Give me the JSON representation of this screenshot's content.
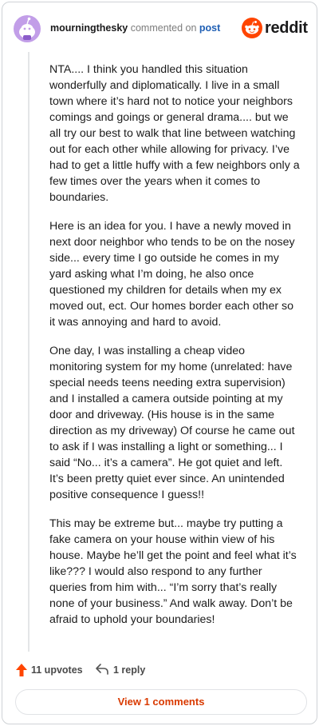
{
  "header": {
    "username": "mourningthesky",
    "commented_on": "commented on",
    "post_link": "post",
    "brand": "reddit"
  },
  "comment": {
    "paragraphs": [
      "NTA.... I think you handled this situation wonderfully and diplomatically. I live in a small town where it’s hard not to notice your neighbors comings and goings or general drama.... but we all try our best to walk that line between watching out for each other while allowing for privacy. I’ve had to get a little huffy with a few neighbors only a few times over the years when it comes to boundaries.",
      "Here is an idea for you. I have a newly moved in next door neighbor who tends to be on the nosey side... every time I go outside he comes in my yard asking what I’m doing, he also once questioned my children for details when my ex moved out, ect. Our homes border each other so it was annoying and hard to avoid.",
      "One day, I was installing a cheap video monitoring system for my home (unrelated: have special needs teens needing extra supervision) and I installed a camera outside pointing at my door and driveway. (His house is in the same direction as my driveway) Of course he came out to ask if I was installing a light or something... I said “No... it’s a camera”. He got quiet and left. It’s been pretty quiet ever since. An unintended positive consequence I guess!!",
      "This may be extreme but... maybe try putting a fake camera on your house within view of his house. Maybe he’ll get the point and feel what it’s like??? I would also respond to any further queries from him with... “I’m sorry that’s really none of your business.” And walk away. Don’t be afraid to uphold your boundaries!"
    ]
  },
  "actions": {
    "upvotes": "11 upvotes",
    "replies": "1 reply",
    "view_comments": "View 1 comments"
  },
  "colors": {
    "brand_orange": "#ff4500",
    "link_blue": "#1f5fb4",
    "button_text": "#d93a00",
    "avatar_purple": "#c29ee8"
  },
  "icons": [
    "avatar",
    "reddit-logo-icon",
    "upvote-arrow-icon",
    "reply-arrow-icon"
  ]
}
